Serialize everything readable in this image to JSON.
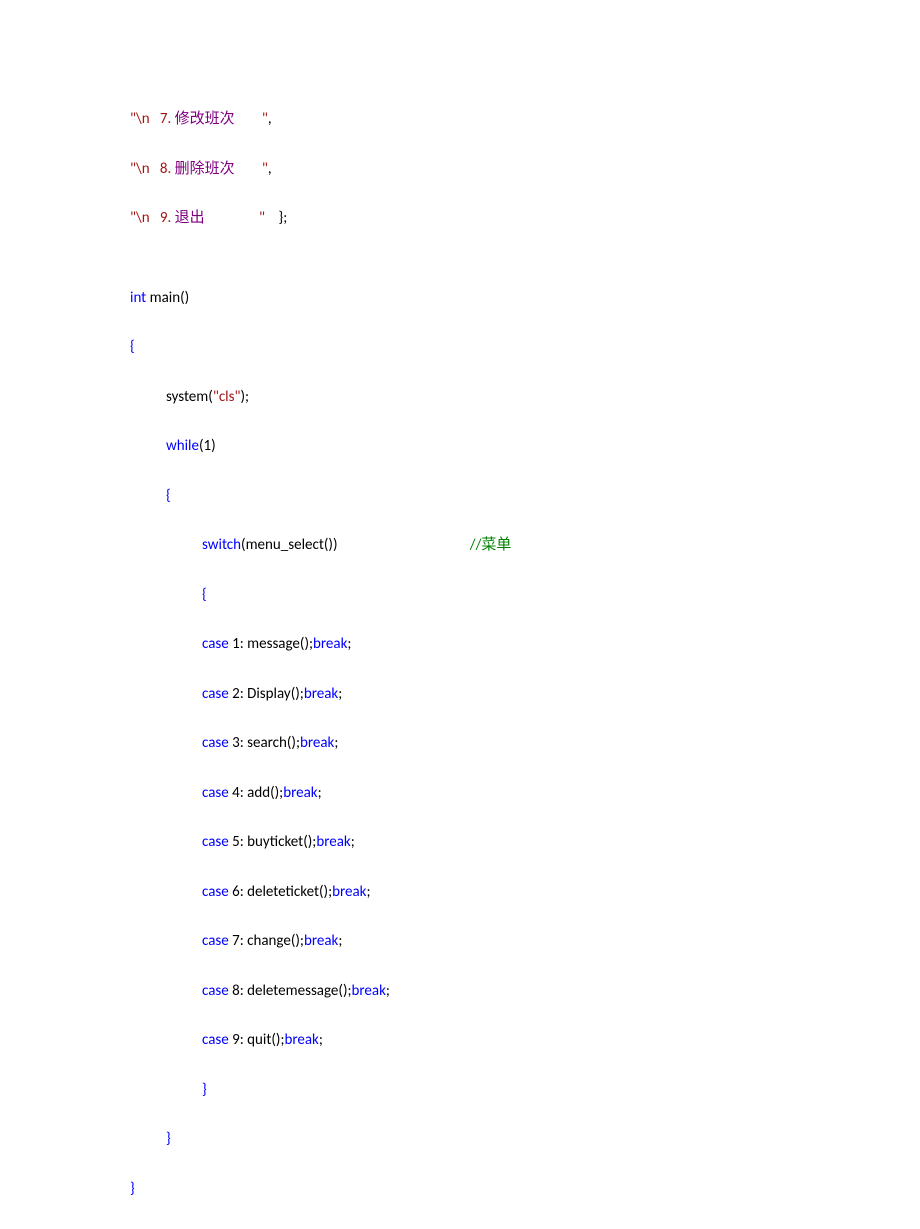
{
  "lines": {
    "l1": {
      "q1": "\"\\n",
      "num": "   7. ",
      "label": "修改班次",
      "pad": "        ",
      "q2": "\"",
      "after": ","
    },
    "l2": {
      "q1": "\"\\n",
      "num": "   8. ",
      "label": "删除班次",
      "pad": "        ",
      "q2": "\"",
      "after": ","
    },
    "l3": {
      "q1": "\"\\n",
      "num": "   9. ",
      "label": "退出",
      "pad": "                ",
      "q2": "\"",
      "after": "    };"
    },
    "l4": {
      "kw": "int",
      "rest": " main()"
    },
    "l5": {
      "brace": "{"
    },
    "l6": {
      "pre": "system(",
      "str": "\"cls\"",
      "post": ");"
    },
    "l7": {
      "kw": "while",
      "rest": "(1)"
    },
    "l8": {
      "brace": "{"
    },
    "l9": {
      "kw": "switch",
      "rest": "(menu_select())",
      "gap": "                                       ",
      "cmt_slashes": "//",
      "cmt_text": "菜单"
    },
    "l10": {
      "brace": "{"
    },
    "l11": {
      "kw": "case",
      "mid": " 1: message();",
      "br": "break",
      "semi": ";"
    },
    "l12": {
      "kw": "case",
      "mid": " 2: Display();",
      "br": "break",
      "semi": ";"
    },
    "l13": {
      "kw": "case",
      "mid": " 3: search();",
      "br": "break",
      "semi": ";"
    },
    "l14": {
      "kw": "case",
      "mid": " 4: add();",
      "br": "break",
      "semi": ";"
    },
    "l15": {
      "kw": "case",
      "mid": " 5: buyticket();",
      "br": "break",
      "semi": ";"
    },
    "l16": {
      "kw": "case",
      "mid": " 6: deleteticket();",
      "br": "break",
      "semi": ";"
    },
    "l17": {
      "kw": "case",
      "mid": " 7: change();",
      "br": "break",
      "semi": ";"
    },
    "l18": {
      "kw": "case",
      "mid": " 8: deletemessage();",
      "br": "break",
      "semi": ";"
    },
    "l19": {
      "kw": "case",
      "mid": " 9: quit();",
      "br": "break",
      "semi": ";"
    },
    "l20": {
      "brace": "}"
    },
    "l21": {
      "brace": "}"
    },
    "l22": {
      "brace": "}"
    }
  }
}
